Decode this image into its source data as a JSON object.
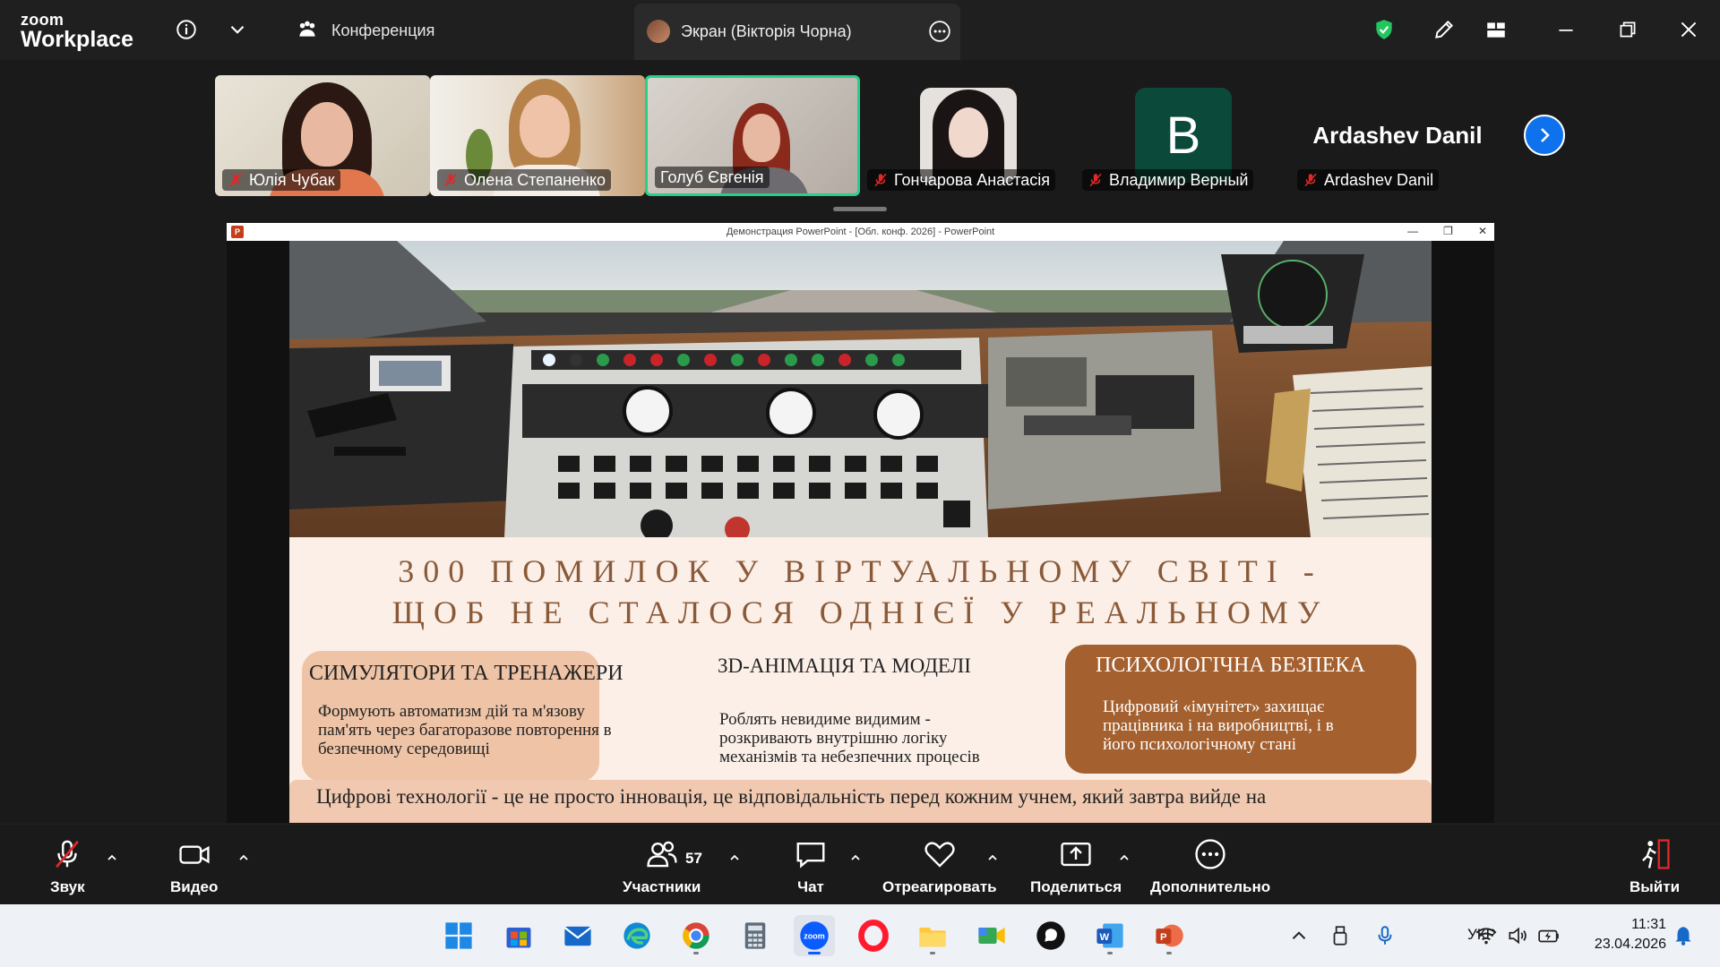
{
  "app": {
    "brand_line1": "zoom",
    "brand_line2": "Workplace",
    "conference_label": "Конференция",
    "screen_tab_label": "Экран (Вікторія Чорна)"
  },
  "participants": [
    {
      "name": "Юлія Чубак",
      "muted": true
    },
    {
      "name": "Олена Степаненко",
      "muted": true
    },
    {
      "name": "Голуб Євгенія",
      "muted": false,
      "active_speaker": true
    },
    {
      "name": "Гончарова Анастасія",
      "muted": true
    },
    {
      "name": "Владимир Верный",
      "muted": true,
      "avatar_letter": "B"
    },
    {
      "name": "Ardashev Danil",
      "muted": true,
      "display_text": "Ardashev Danil"
    }
  ],
  "powerpoint": {
    "window_title": "Демонстрация PowerPoint - [Обл. конф. 2026] - PowerPoint",
    "logo_letter": "P"
  },
  "slide": {
    "title_line1": "300 ПОМИЛОК У ВІРТУАЛЬНОМУ СВІТІ -",
    "title_line2": "ЩОБ НЕ СТАЛОСЯ ОДНІЄЇ У РЕАЛЬНОМУ",
    "boxes": [
      {
        "heading": "СИМУЛЯТОРИ ТА ТРЕНАЖЕРИ",
        "body": [
          "Формують автоматизм дій та м'язову",
          "пам'ять через багаторазове повторення в",
          "безпечному середовищі"
        ]
      },
      {
        "heading": "3D-АНІМАЦІЯ ТА МОДЕЛІ",
        "body": [
          "Роблять невидиме видимим -",
          "розкривають внутрішню логіку",
          "механізмів та небезпечних процесів"
        ]
      },
      {
        "heading": "ПСИХОЛОГІЧНА БЕЗПЕКА",
        "body": [
          "Цифровий «імунітет» захищає",
          "працівника і на виробництві, і в",
          "його психологічному стані"
        ]
      }
    ],
    "footer": "Цифрові технології - це не просто інновація, це відповідальність перед кожним учнем, який завтра вийде на"
  },
  "toolbar": {
    "audio_label": "Звук",
    "video_label": "Видео",
    "participants_label": "Участники",
    "participants_count": "57",
    "chat_label": "Чат",
    "react_label": "Отреагировать",
    "share_label": "Поделиться",
    "more_label": "Дополнительно",
    "leave_label": "Выйти"
  },
  "taskbar": {
    "language": "УКР",
    "time": "11:31",
    "date": "23.04.2026"
  },
  "colors": {
    "slide_title": "#8a5a38",
    "box_light": "#eec3a6",
    "box_dark": "#a4602e",
    "active_speaker_border": "#23d18b",
    "shield": "#22c55e",
    "nav_button": "#0e72ed",
    "muted_red": "#e02828"
  }
}
